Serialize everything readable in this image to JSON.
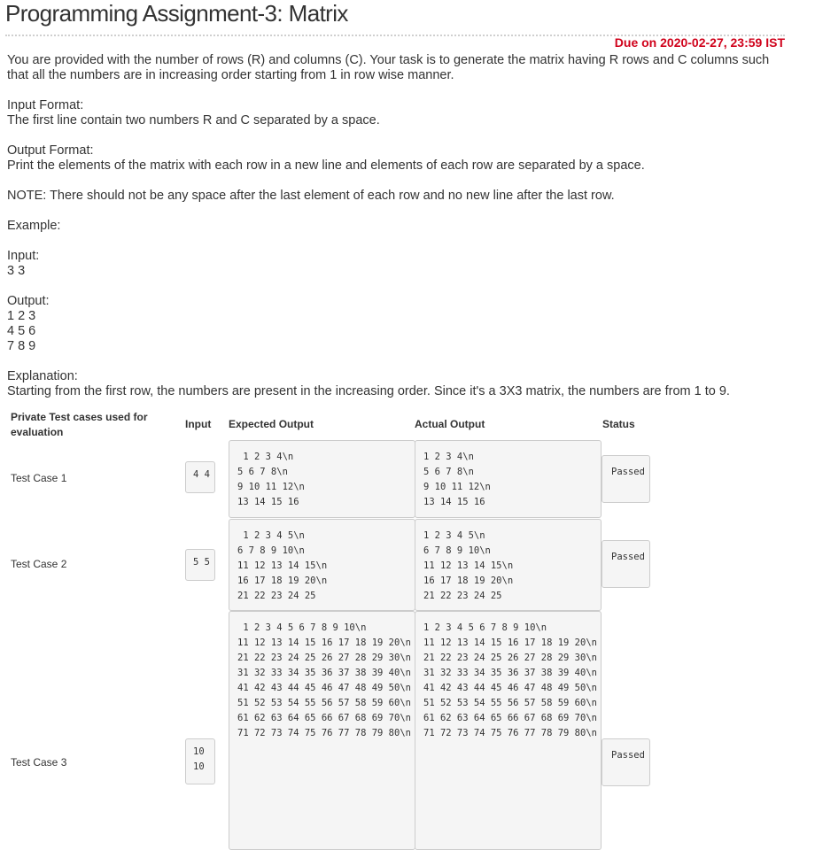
{
  "header": {
    "title": "Programming Assignment-3: Matrix",
    "due": "Due on 2020-02-27, 23:59 IST"
  },
  "problem": {
    "intro": "You are provided with the number of rows (R) and columns (C). Your task is to generate the matrix having R rows and C columns such that all the numbers are in increasing order starting from 1 in row wise manner.",
    "input_heading": "Input Format:",
    "input_text": "The first line contain two numbers R and C separated by a space.",
    "output_heading": "Output Format:",
    "output_text": "Print the elements of the matrix with each row in a new line and elements of each row are separated by a space.",
    "note": "NOTE: There should not be any space after the last element of each row and no new line after the last row.",
    "example_heading": "Example:",
    "example_input_heading": "Input:",
    "example_input": "3 3",
    "example_output_heading": "Output:",
    "example_output_lines": [
      "1 2 3",
      "4 5 6",
      "7 8 9"
    ],
    "explanation_heading": "Explanation:",
    "explanation_text": "Starting from the first row, the numbers are present in the increasing order. Since it's a 3X3 matrix, the numbers are from 1 to 9."
  },
  "tests": {
    "headers": {
      "private": "Private Test cases used for evaluation",
      "input": "Input",
      "expected": "Expected Output",
      "actual": "Actual Output",
      "status": "Status"
    },
    "cases": [
      {
        "label": "Test Case 1",
        "input": "4 4",
        "expected": " 1 2 3 4\\n\n5 6 7 8\\n\n9 10 11 12\\n\n13 14 15 16",
        "actual": "1 2 3 4\\n\n5 6 7 8\\n\n9 10 11 12\\n\n13 14 15 16",
        "status": "Passed"
      },
      {
        "label": "Test Case 2",
        "input": "5 5",
        "expected": " 1 2 3 4 5\\n\n6 7 8 9 10\\n\n11 12 13 14 15\\n\n16 17 18 19 20\\n\n21 22 23 24 25",
        "actual": "1 2 3 4 5\\n\n6 7 8 9 10\\n\n11 12 13 14 15\\n\n16 17 18 19 20\\n\n21 22 23 24 25",
        "status": "Passed"
      },
      {
        "label": "Test Case 3",
        "input": "10 10",
        "expected": " 1 2 3 4 5 6 7 8 9 10\\n\n11 12 13 14 15 16 17 18 19 20\\n\n21 22 23 24 25 26 27 28 29 30\\n\n31 32 33 34 35 36 37 38 39 40\\n\n41 42 43 44 45 46 47 48 49 50\\n\n51 52 53 54 55 56 57 58 59 60\\n\n61 62 63 64 65 66 67 68 69 70\\n\n71 72 73 74 75 76 77 78 79 80\\n",
        "actual": "1 2 3 4 5 6 7 8 9 10\\n\n11 12 13 14 15 16 17 18 19 20\\n\n21 22 23 24 25 26 27 28 29 30\\n\n31 32 33 34 35 36 37 38 39 40\\n\n41 42 43 44 45 46 47 48 49 50\\n\n51 52 53 54 55 56 57 58 59 60\\n\n61 62 63 64 65 66 67 68 69 70\\n\n71 72 73 74 75 76 77 78 79 80\\n",
        "status": "Passed"
      }
    ]
  }
}
